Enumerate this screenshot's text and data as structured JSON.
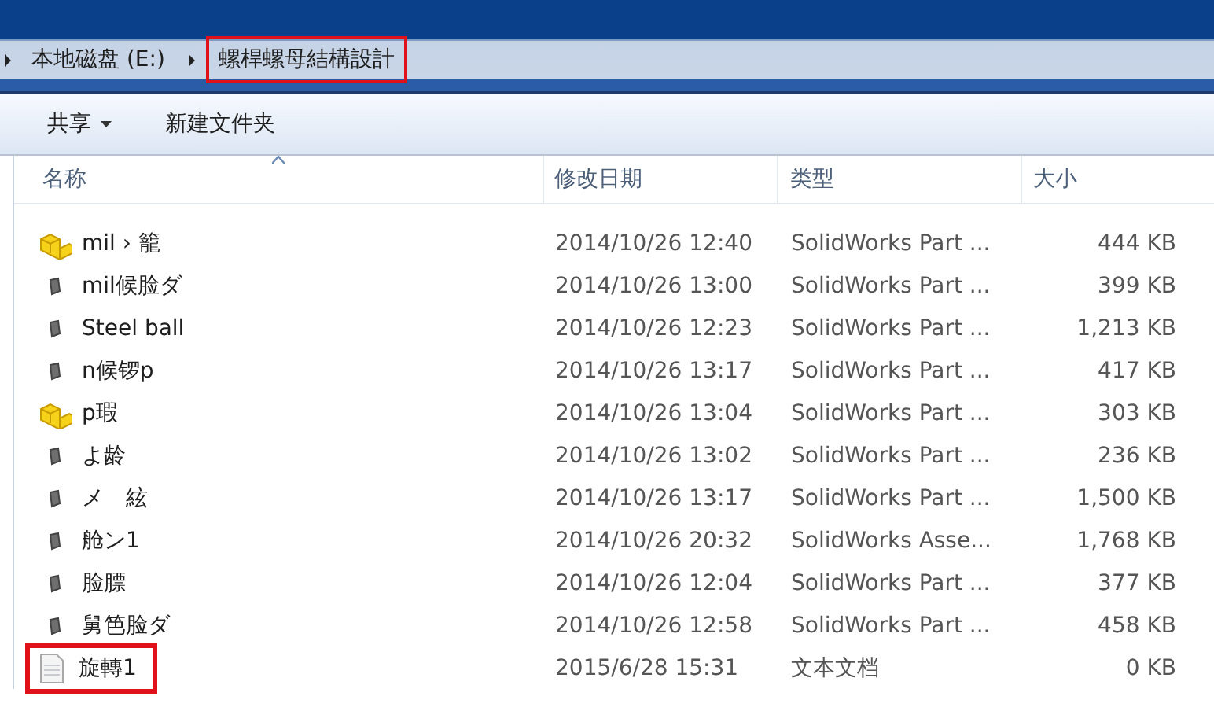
{
  "breadcrumb": [
    {
      "label": "本地磁盘 (E:)",
      "highlighted": false
    },
    {
      "label": "螺桿螺母結構設計",
      "highlighted": true
    }
  ],
  "toolbar": [
    {
      "label": "共享",
      "dropdown": true
    },
    {
      "label": "新建文件夹",
      "dropdown": false
    }
  ],
  "table": {
    "columns": [
      {
        "label": "名称",
        "sorted": true
      },
      {
        "label": "修改日期",
        "sorted": false
      },
      {
        "label": "类型",
        "sorted": false
      },
      {
        "label": "大小",
        "sorted": false
      }
    ],
    "rows": [
      {
        "kind": "assembly",
        "name": "mil › 籠",
        "date": "2014/10/26 12:40",
        "type": "SolidWorks Part ...",
        "size": "444 KB",
        "highlighted": false
      },
      {
        "kind": "part",
        "name": "mil候脸ダ",
        "date": "2014/10/26 13:00",
        "type": "SolidWorks Part ...",
        "size": "399 KB",
        "highlighted": false
      },
      {
        "kind": "part",
        "name": "Steel ball",
        "date": "2014/10/26 12:23",
        "type": "SolidWorks Part ...",
        "size": "1,213 KB",
        "highlighted": false
      },
      {
        "kind": "part",
        "name": "n候锣p",
        "date": "2014/10/26 13:17",
        "type": "SolidWorks Part ...",
        "size": "417 KB",
        "highlighted": false
      },
      {
        "kind": "assembly",
        "name": "p瑕",
        "date": "2014/10/26 13:04",
        "type": "SolidWorks Part ...",
        "size": "303 KB",
        "highlighted": false
      },
      {
        "kind": "part",
        "name": "よ龄",
        "date": "2014/10/26 13:02",
        "type": "SolidWorks Part ...",
        "size": "236 KB",
        "highlighted": false
      },
      {
        "kind": "part",
        "name": "メ　絃",
        "date": "2014/10/26 13:17",
        "type": "SolidWorks Part ...",
        "size": "1,500 KB",
        "highlighted": false
      },
      {
        "kind": "part",
        "name": "舱ン1",
        "date": "2014/10/26 20:32",
        "type": "SolidWorks Asse...",
        "size": "1,768 KB",
        "highlighted": false
      },
      {
        "kind": "part",
        "name": "脸膘",
        "date": "2014/10/26 12:04",
        "type": "SolidWorks Part ...",
        "size": "377 KB",
        "highlighted": false
      },
      {
        "kind": "part",
        "name": "舅笆脸ダ",
        "date": "2014/10/26 12:58",
        "type": "SolidWorks Part ...",
        "size": "458 KB",
        "highlighted": false
      },
      {
        "kind": "text",
        "name": "旋轉1",
        "date": "2015/6/28 15:31",
        "type": "文本文档",
        "size": "0 KB",
        "highlighted": true
      }
    ]
  }
}
